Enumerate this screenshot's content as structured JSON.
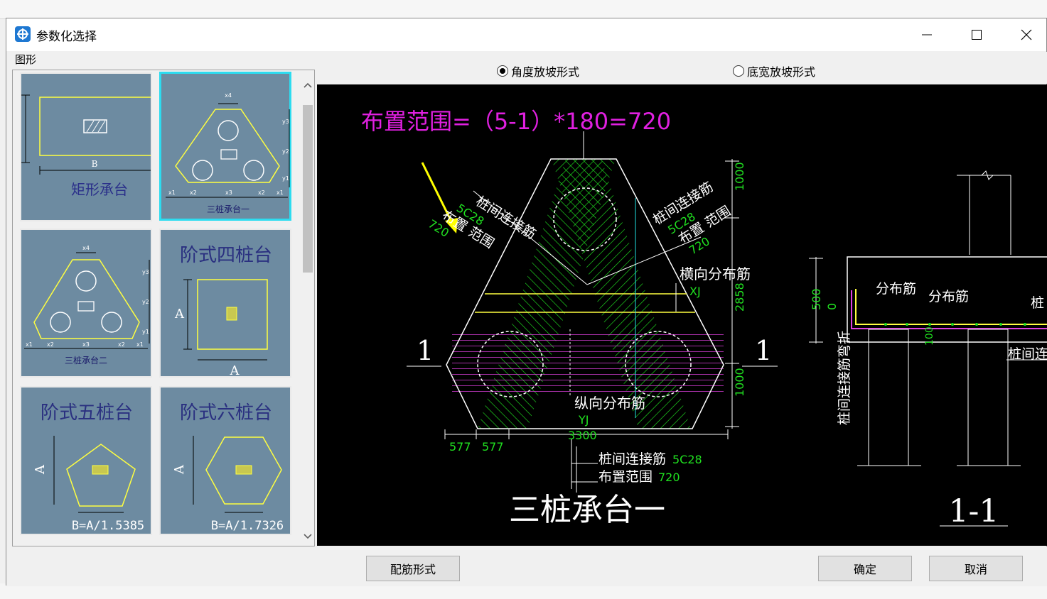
{
  "window": {
    "title": "参数化选择"
  },
  "shape_group_label": "图形",
  "thumbnails": [
    {
      "label": "矩形承台",
      "dim_b": "B",
      "selected": false
    },
    {
      "label": "三桩承台一",
      "selected": true
    },
    {
      "label": "三桩承台二",
      "selected": false
    },
    {
      "label": "阶式四桩台",
      "dim_a": "A",
      "selected": false
    },
    {
      "label": "阶式五桩台",
      "formula": "B=A/1.5385",
      "dim_a": "A",
      "selected": false
    },
    {
      "label": "阶式六桩台",
      "formula": "B=A/1.7326",
      "dim_a": "A",
      "selected": false
    }
  ],
  "slope_options": [
    {
      "label": "角度放坡形式",
      "selected": true
    },
    {
      "label": "底宽放坡形式",
      "selected": false
    }
  ],
  "drawing": {
    "annotation": "布置范围=（5-1）*180=720",
    "left_bar_label": "桩间连接筋",
    "left_bar_spec": "5C28",
    "left_range_label": "布置 范围",
    "left_range_value": "720",
    "right_bar_label": "桩间连接筋",
    "right_bar_spec": "5C28",
    "right_range_label": "布置 范围",
    "right_range_value": "720",
    "transverse_label": "横向分布筋",
    "xj": "XJ",
    "longitudinal_label": "纵向分布筋",
    "yj": "YJ",
    "dim_top": "1000",
    "dim_mid": "2858",
    "dim_bottom": "1000",
    "dim_577a": "577",
    "dim_577b": "577",
    "dim_3300": "3300",
    "bottom_bar_label": "桩间连接筋",
    "bottom_bar_spec": "5C28",
    "bottom_range_label": "布置范围",
    "bottom_range_value": "720",
    "section_mark_left": "1",
    "section_mark_right": "1",
    "plan_title": "三桩承台一",
    "section_title": "1-1",
    "sec_distrib_1": "分布筋",
    "sec_distrib_2": "分布筋",
    "sec_pile_partial": "桩",
    "sec_dim_500": "500",
    "sec_dim_0": "0",
    "sec_dim_100": "100",
    "sec_bend_label": "桩间连接筋弯折",
    "sec_pile_conn_partial": "桩间连"
  },
  "buttons": {
    "rebar_form": "配筋形式",
    "ok": "确定",
    "cancel": "取消"
  },
  "colors": {
    "thumb_bg": "#6d8ba1",
    "selected_border": "#2cdcf0",
    "canvas_bg": "#000000",
    "annotation": "#e020e0",
    "rebar_green": "#20e020",
    "magenta_rebar": "#e040e0",
    "arrow": "#ffff00"
  }
}
